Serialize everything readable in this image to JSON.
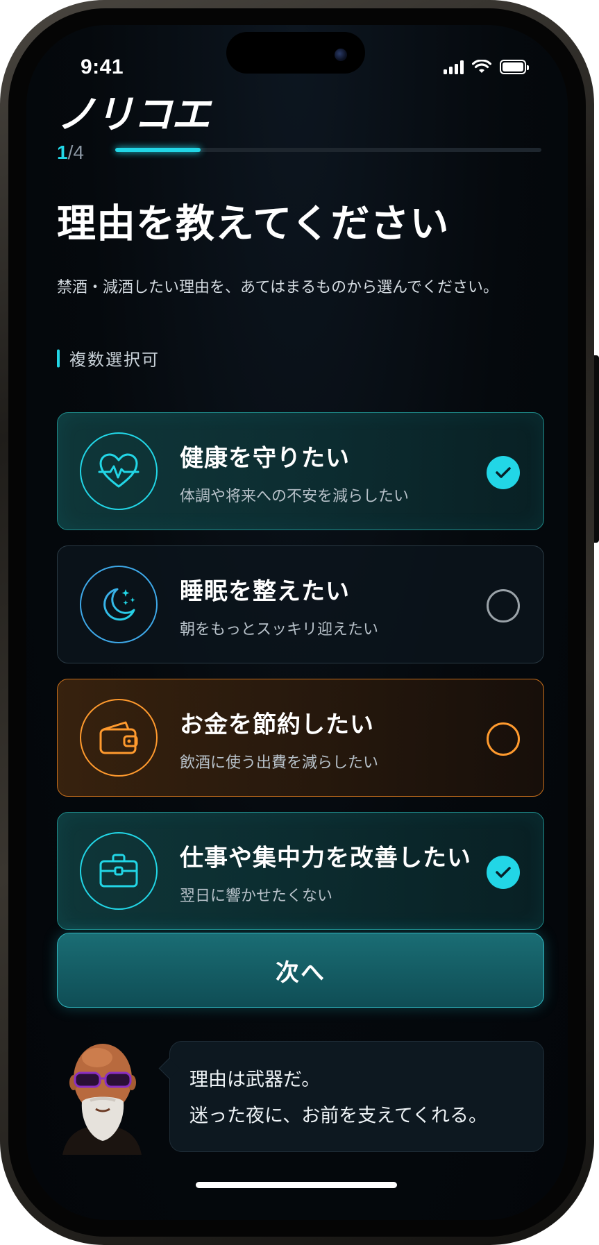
{
  "status_bar": {
    "time": "9:41"
  },
  "app": {
    "logo": "ノリコエ"
  },
  "progress": {
    "current": "1",
    "separator": "/",
    "total": "4",
    "fraction": 0.2
  },
  "header": {
    "title": "理由を教えてください",
    "subtitle": "禁酒・減酒したい理由を、あてはまるものから選んでください。"
  },
  "selection_hint": "複数選択可",
  "options": [
    {
      "title": "健康を守りたい",
      "description": "体調や将来への不安を減らしたい",
      "icon": "heart-pulse-icon",
      "selected": true
    },
    {
      "title": "睡眠を整えたい",
      "description": "朝をもっとスッキリ迎えたい",
      "icon": "moon-stars-icon",
      "selected": false
    },
    {
      "title": "お金を節約したい",
      "description": "飲酒に使う出費を減らしたい",
      "icon": "wallet-icon",
      "selected": false
    },
    {
      "title": "仕事や集中力を改善したい",
      "description": "翌日に響かせたくない",
      "icon": "briefcase-icon",
      "selected": true
    }
  ],
  "next_button": {
    "label": "次へ"
  },
  "coach": {
    "message_line1": "理由は武器だ。",
    "message_line2": "迷った夜に、お前を支えてくれる。"
  },
  "colors": {
    "accent": "#22d6e6",
    "orange": "#ff9a2e",
    "background": "#05090d"
  }
}
